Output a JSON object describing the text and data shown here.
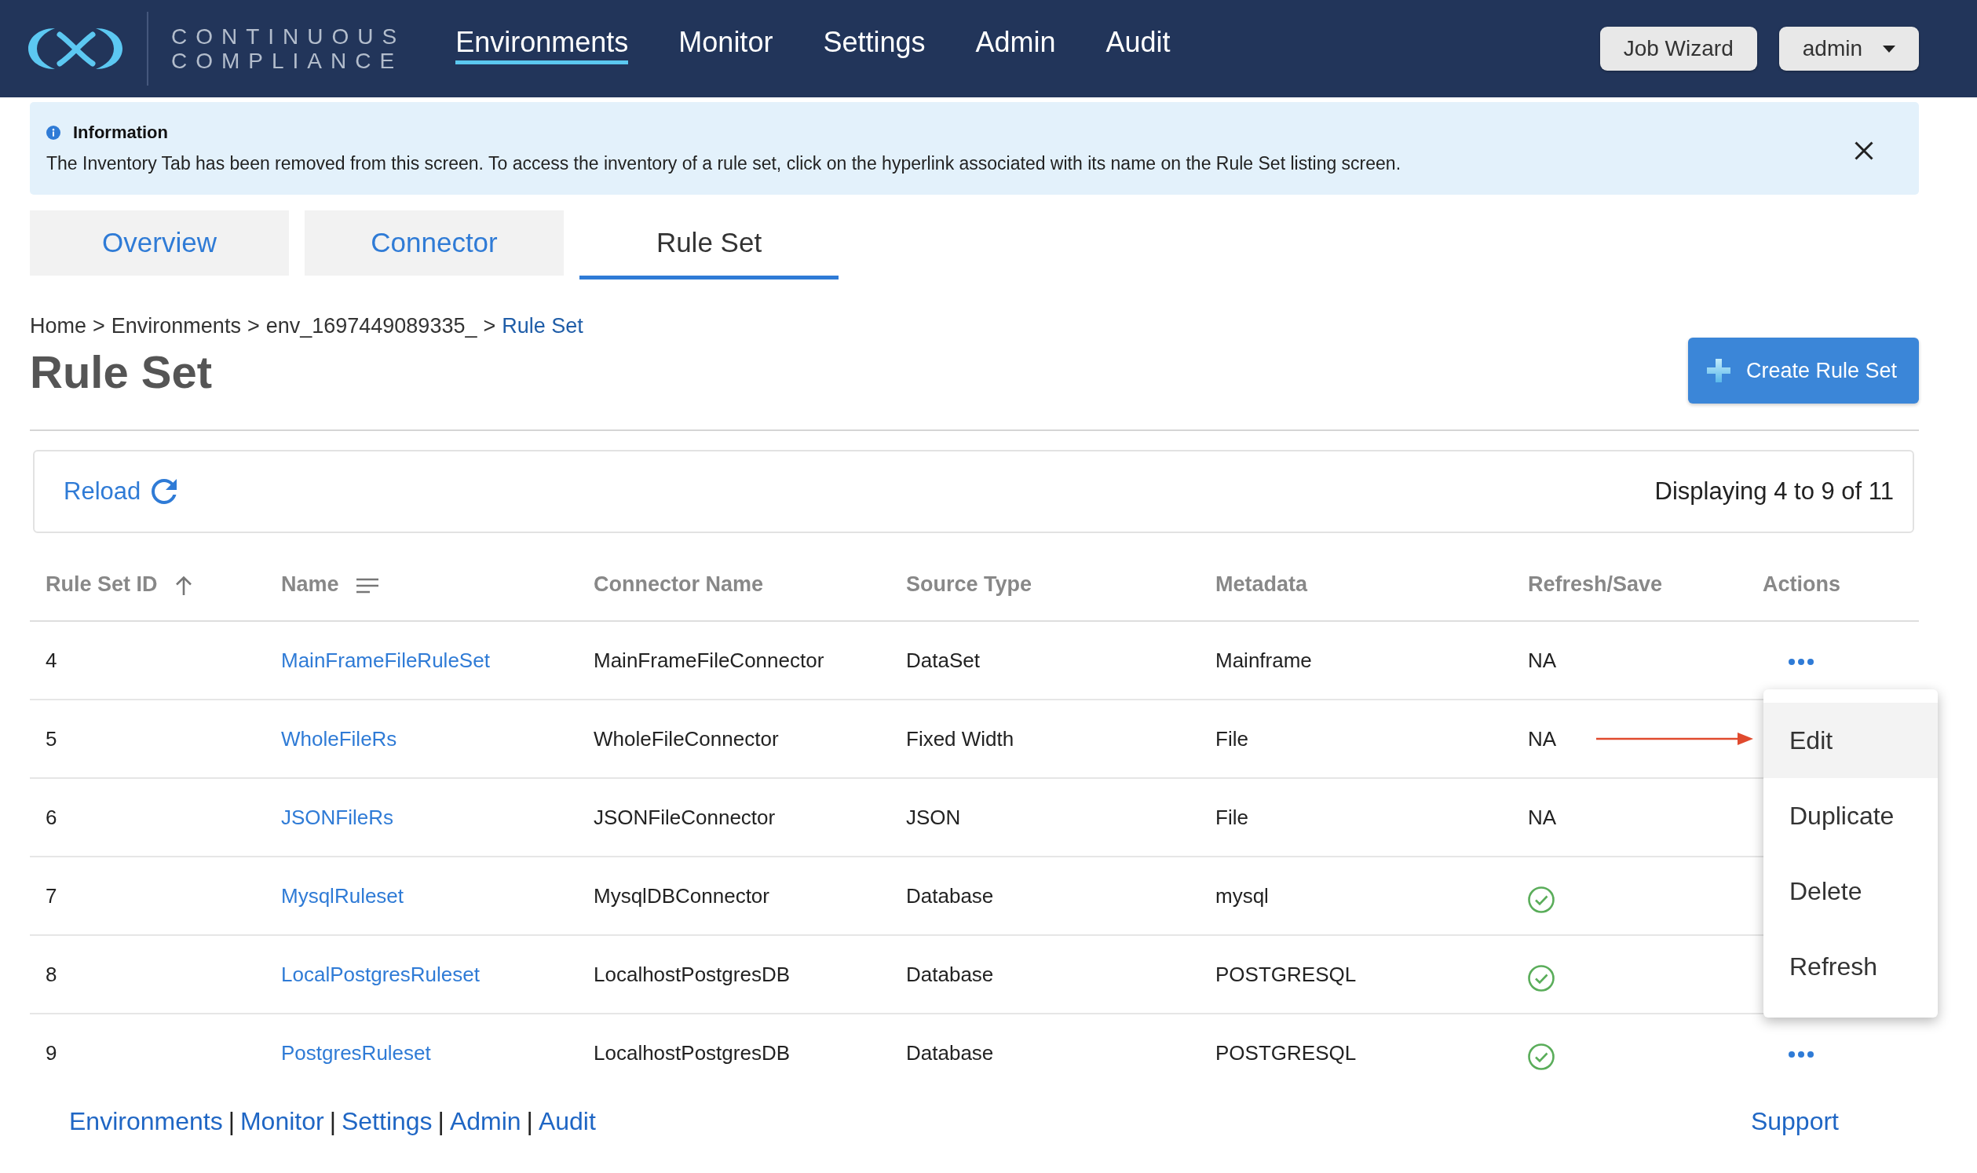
{
  "header": {
    "logo": {
      "lines": [
        "CONTINUOUS",
        "COMPLIANCE"
      ]
    },
    "nav": [
      {
        "label": "Environments",
        "selected": true
      },
      {
        "label": "Monitor",
        "selected": false
      },
      {
        "label": "Settings",
        "selected": false
      },
      {
        "label": "Admin",
        "selected": false
      },
      {
        "label": "Audit",
        "selected": false
      }
    ],
    "buttons": [
      {
        "label": "Job Wizard",
        "kind": "plain"
      },
      {
        "label": "admin",
        "kind": "dropdown"
      }
    ]
  },
  "alert": {
    "title": "Information",
    "message": "The Inventory Tab has been removed from this screen. To access the inventory of a rule set, click on the hyperlink associated with its name on the Rule Set listing screen."
  },
  "tabs": [
    {
      "label": "Overview",
      "selected": false
    },
    {
      "label": "Connector",
      "selected": false
    },
    {
      "label": "Rule Set",
      "selected": true
    }
  ],
  "breadcrumb": {
    "separator": ">",
    "items": [
      {
        "label": "Home",
        "current": false
      },
      {
        "label": "Environments",
        "current": false
      },
      {
        "label": "env_1697449089335_",
        "current": false
      },
      {
        "label": "Rule Set",
        "current": true
      }
    ]
  },
  "page_title": "Rule Set",
  "create_button": "Create Rule Set",
  "toolbar": {
    "reload": "Reload",
    "summary": "Displaying 4 to 9 of 11"
  },
  "table": {
    "columns": [
      {
        "label": "Rule Set ID",
        "kind": "sorted"
      },
      {
        "label": "Name",
        "kind": "sortable"
      },
      {
        "label": "Connector Name",
        "kind": "plain"
      },
      {
        "label": "Source Type",
        "kind": "plain"
      },
      {
        "label": "Metadata",
        "kind": "plain"
      },
      {
        "label": "Refresh/Save",
        "kind": "plain"
      },
      {
        "label": "Actions",
        "kind": "plain"
      }
    ],
    "rows": [
      {
        "id": "4",
        "name": "MainFrameFileRuleSet",
        "connector_name": "MainFrameFileConnector",
        "source_type": "DataSet",
        "metadata": "Mainframe",
        "refresh_save": {
          "kind": "text",
          "text": "NA"
        }
      },
      {
        "id": "5",
        "name": "WholeFileRs",
        "connector_name": "WholeFileConnector",
        "source_type": "Fixed Width",
        "metadata": "File",
        "refresh_save": {
          "kind": "text",
          "text": "NA"
        }
      },
      {
        "id": "6",
        "name": "JSONFileRs",
        "connector_name": "JSONFileConnector",
        "source_type": "JSON",
        "metadata": "File",
        "refresh_save": {
          "kind": "text",
          "text": "NA"
        }
      },
      {
        "id": "7",
        "name": "MysqlRuleset",
        "connector_name": "MysqlDBConnector",
        "source_type": "Database",
        "metadata": "mysql",
        "refresh_save": {
          "kind": "check"
        }
      },
      {
        "id": "8",
        "name": "LocalPostgresRuleset",
        "connector_name": "LocalhostPostgresDB",
        "source_type": "Database",
        "metadata": "POSTGRESQL",
        "refresh_save": {
          "kind": "check"
        }
      },
      {
        "id": "9",
        "name": "PostgresRuleset",
        "connector_name": "LocalhostPostgresDB",
        "source_type": "Database",
        "metadata": "POSTGRESQL",
        "refresh_save": {
          "kind": "check"
        }
      }
    ]
  },
  "actions_menu": {
    "items": [
      {
        "label": "Edit",
        "selected": true
      },
      {
        "label": "Duplicate",
        "selected": false
      },
      {
        "label": "Delete",
        "selected": false
      },
      {
        "label": "Refresh",
        "selected": false
      }
    ]
  },
  "footer": {
    "separator": "|",
    "links": [
      "Environments",
      "Monitor",
      "Settings",
      "Admin",
      "Audit"
    ],
    "support": "Support"
  }
}
